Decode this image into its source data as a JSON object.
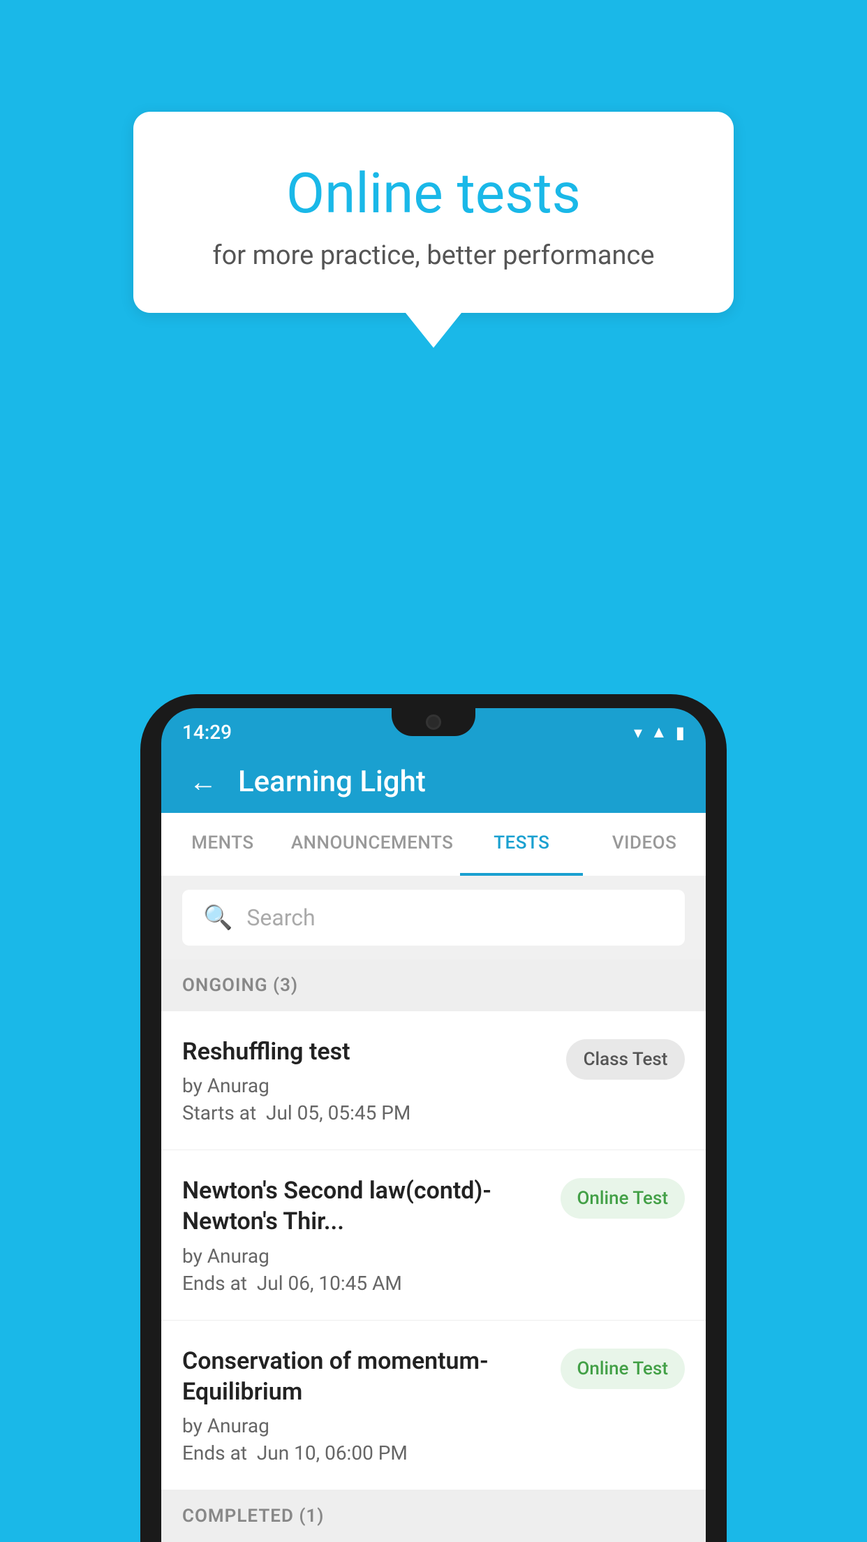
{
  "background_color": "#1ab8e8",
  "speech_bubble": {
    "title": "Online tests",
    "subtitle": "for more practice, better performance"
  },
  "phone": {
    "status_bar": {
      "time": "14:29"
    },
    "app_header": {
      "title": "Learning Light",
      "back_label": "←"
    },
    "tabs": [
      {
        "label": "MENTS",
        "active": false
      },
      {
        "label": "ANNOUNCEMENTS",
        "active": false
      },
      {
        "label": "TESTS",
        "active": true
      },
      {
        "label": "VIDEOS",
        "active": false
      }
    ],
    "search": {
      "placeholder": "Search"
    },
    "ongoing_section": {
      "label": "ONGOING (3)"
    },
    "tests": [
      {
        "title": "Reshuffling test",
        "author": "by Anurag",
        "time_label": "Starts at",
        "time": "Jul 05, 05:45 PM",
        "badge": "Class Test",
        "badge_type": "class"
      },
      {
        "title": "Newton's Second law(contd)-Newton's Thir...",
        "author": "by Anurag",
        "time_label": "Ends at",
        "time": "Jul 06, 10:45 AM",
        "badge": "Online Test",
        "badge_type": "online"
      },
      {
        "title": "Conservation of momentum-Equilibrium",
        "author": "by Anurag",
        "time_label": "Ends at",
        "time": "Jun 10, 06:00 PM",
        "badge": "Online Test",
        "badge_type": "online"
      }
    ],
    "completed_section": {
      "label": "COMPLETED (1)"
    }
  }
}
